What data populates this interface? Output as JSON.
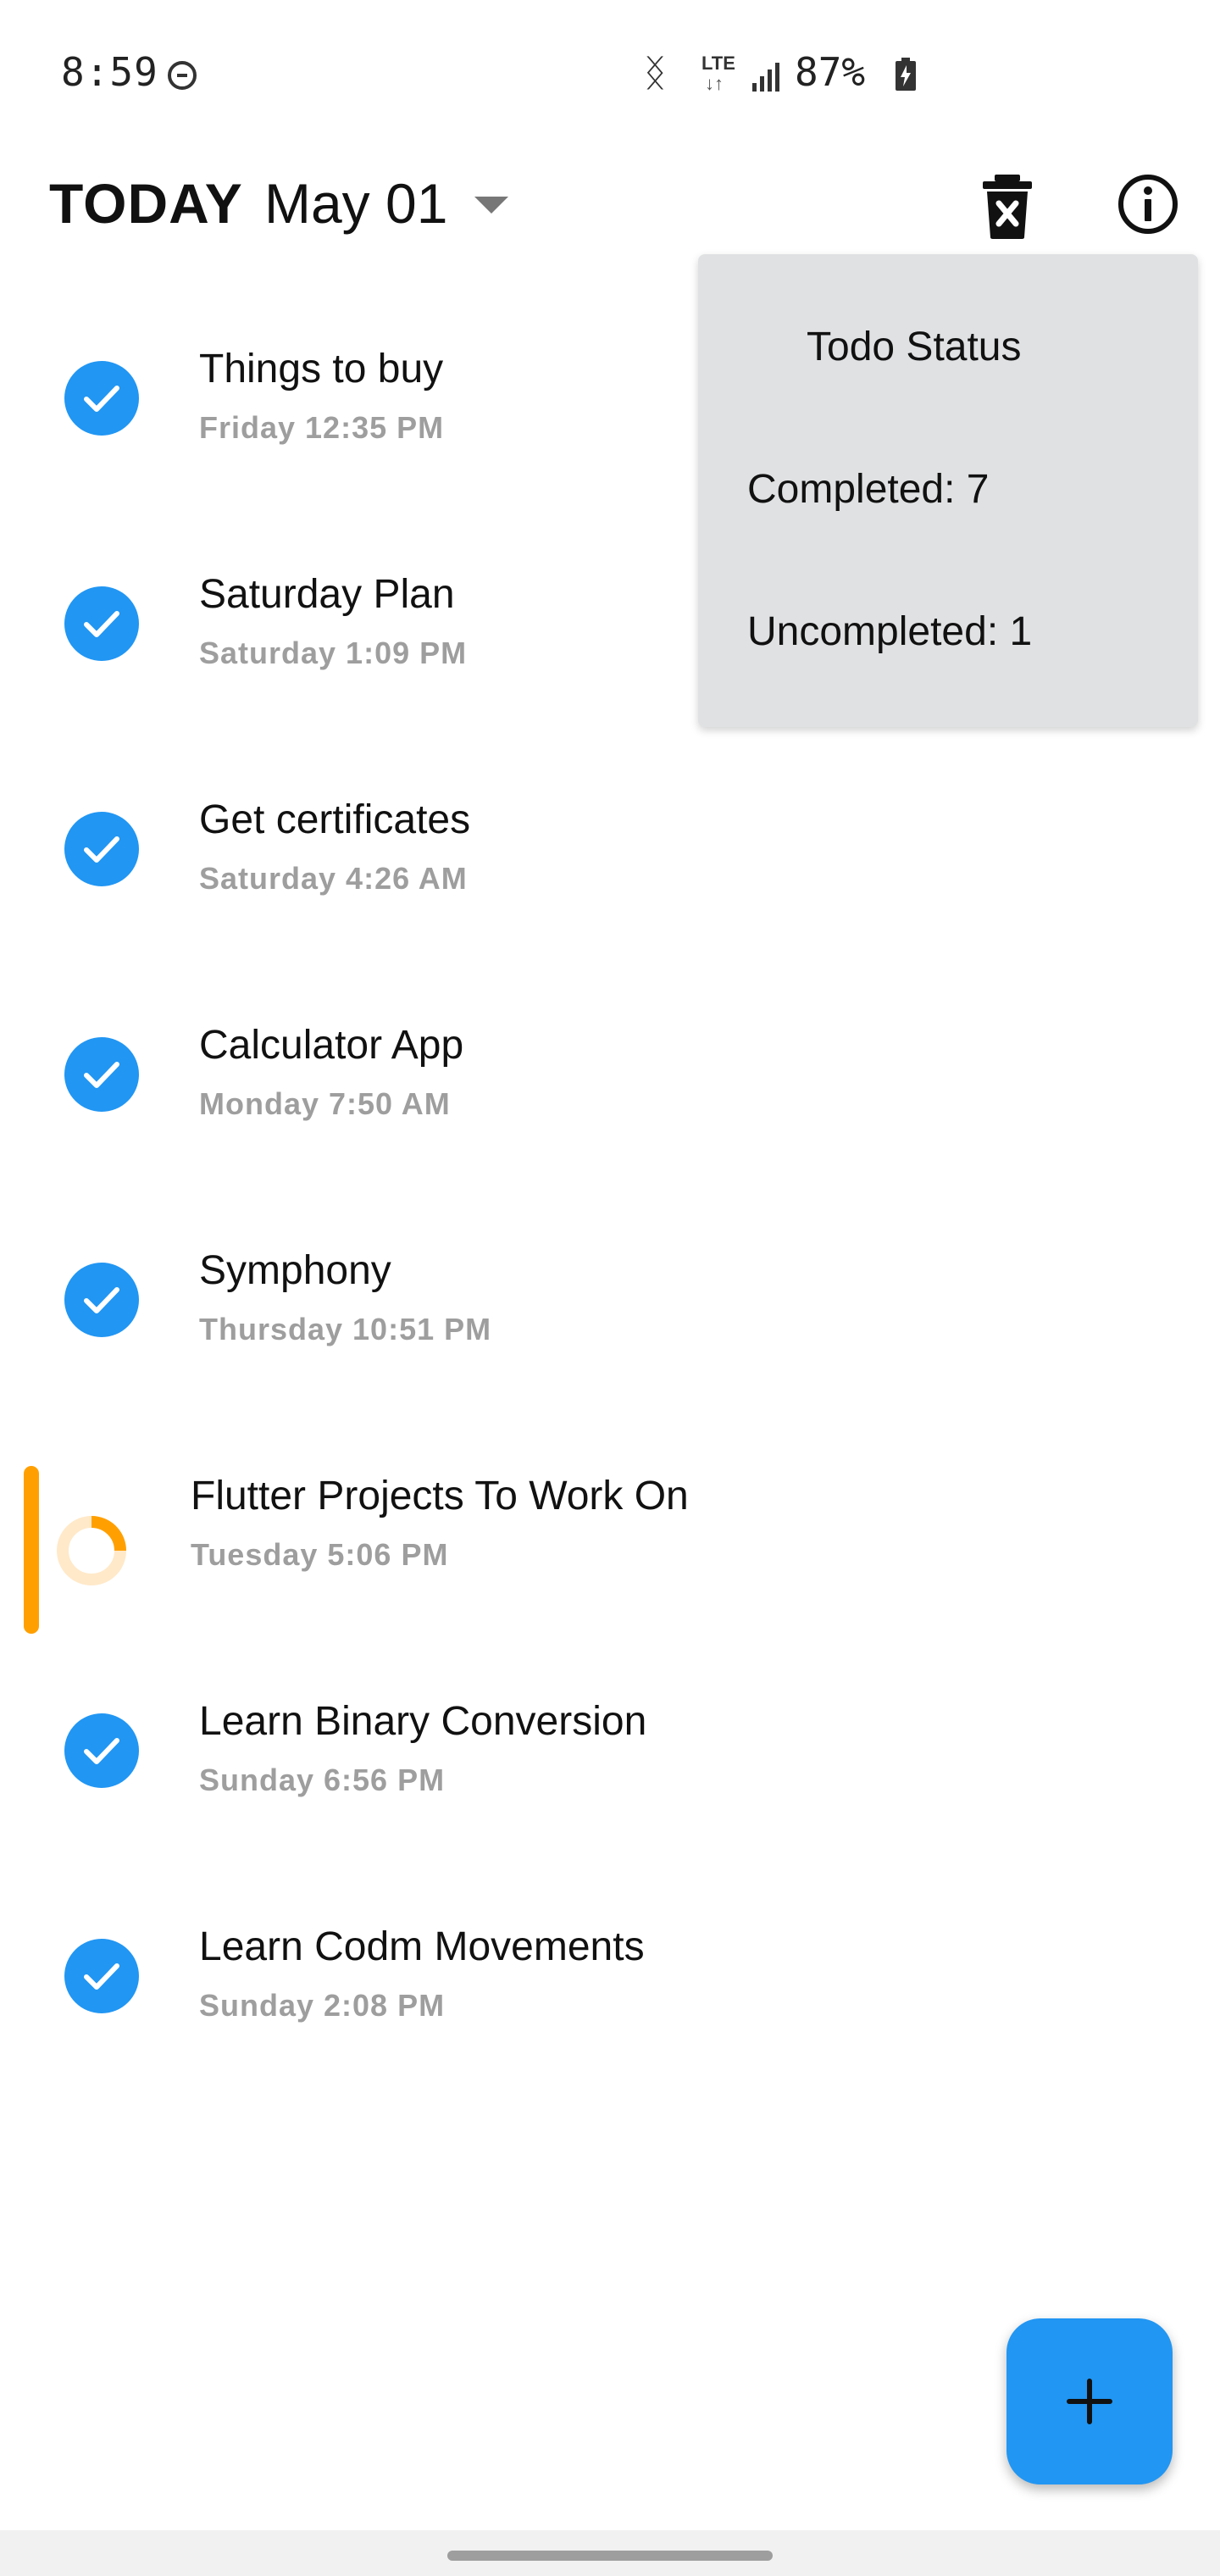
{
  "status_bar": {
    "time": "8:59",
    "network": "LTE",
    "network_arrows": "↓↑",
    "battery": "87%"
  },
  "header": {
    "today_label": "TODAY",
    "date_label": "May 01"
  },
  "todos": [
    {
      "title": "Things to buy",
      "time": "Friday 12:35 PM",
      "completed": true
    },
    {
      "title": "Saturday Plan",
      "time": "Saturday 1:09 PM",
      "completed": true
    },
    {
      "title": "Get certificates",
      "time": "Saturday 4:26 AM",
      "completed": true
    },
    {
      "title": "Calculator App",
      "time": "Monday 7:50 AM",
      "completed": true
    },
    {
      "title": "Symphony",
      "time": "Thursday 10:51 PM",
      "completed": true
    },
    {
      "title": "Flutter Projects To Work On",
      "time": "Tuesday 5:06 PM",
      "completed": false
    },
    {
      "title": "Learn Binary Conversion",
      "time": "Sunday 6:56 PM",
      "completed": true
    },
    {
      "title": "Learn Codm Movements",
      "time": "Sunday 2:08 PM",
      "completed": true
    }
  ],
  "status_popup": {
    "title": "Todo Status",
    "completed": "Completed: 7",
    "uncompleted": "Uncompleted: 1"
  },
  "colors": {
    "accent": "#2196f3",
    "pending": "#ffa000",
    "popup_bg": "#e0e1e3",
    "secondary_text": "#9e9e9e"
  },
  "icons": {
    "trash": "delete-forever-icon",
    "info": "info-icon",
    "fab": "add-icon",
    "check": "check-circle-icon",
    "pending": "progress-ring-icon"
  }
}
